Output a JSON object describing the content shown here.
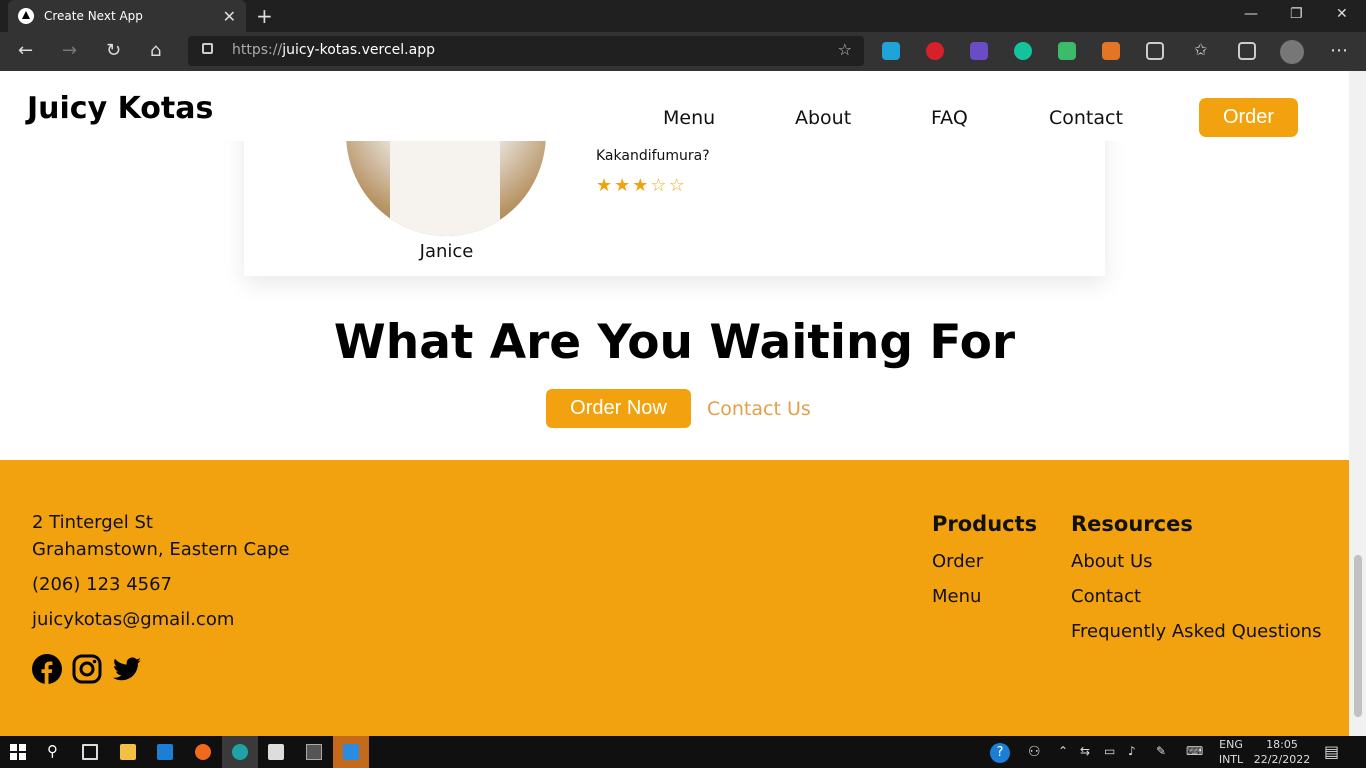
{
  "browser": {
    "tab_title": "Create Next App",
    "tab_close": "✕",
    "new_tab": "+",
    "url_prefix": "https://",
    "url_host": "juicy-kotas.vercel.app",
    "nav": {
      "back": "←",
      "forward": "→",
      "reload": "↻",
      "home": "⌂"
    },
    "window": {
      "minimize": "—",
      "restore": "❐",
      "close": "✕"
    },
    "more": "⋯"
  },
  "site": {
    "brand": "Juicy Kotas",
    "nav": [
      "Menu",
      "About",
      "FAQ",
      "Contact"
    ],
    "order_button": "Order"
  },
  "review": {
    "name": "Janice",
    "text": "Kakandifumura?",
    "rating": 3,
    "max_rating": 5
  },
  "cta": {
    "title": "What Are You Waiting For",
    "order_now": "Order Now",
    "contact_us": "Contact Us"
  },
  "footer": {
    "address_line1": "2 Tintergel St",
    "address_line2": "Grahamstown, Eastern Cape",
    "phone": "(206) 123 4567",
    "email": "juicykotas@gmail.com",
    "products_heading": "Products",
    "products": [
      "Order",
      "Menu"
    ],
    "resources_heading": "Resources",
    "resources": [
      "About Us",
      "Contact",
      "Frequently Asked Questions"
    ],
    "brand_color": "#f2a20f"
  },
  "taskbar": {
    "lang_top": "ENG",
    "lang_bottom": "INTL",
    "time": "18:05",
    "date": "22/2/2022"
  }
}
